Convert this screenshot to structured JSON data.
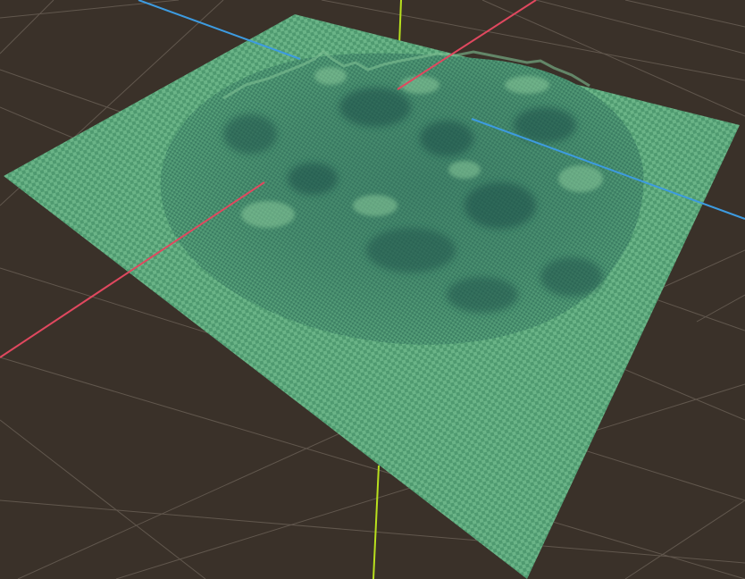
{
  "viewport": {
    "background_color": "#3a3129",
    "grid_color": "#6b6157",
    "axes": {
      "x_color": "#e0485f",
      "y_color": "#b8e01e",
      "z_color": "#3d9be0"
    }
  },
  "terrain": {
    "base_color": "#6ab487",
    "checker_color": "#4f9a70",
    "shade_color": "#2f6a5c",
    "highlight_color": "#8fcf9e"
  }
}
